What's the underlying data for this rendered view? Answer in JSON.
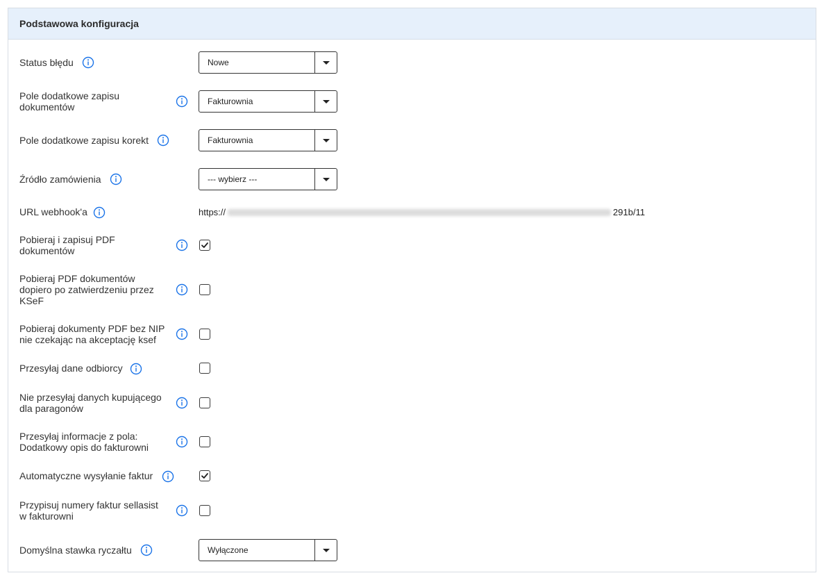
{
  "panel": {
    "title": "Podstawowa konfiguracja"
  },
  "fields": {
    "status": {
      "label": "Status błędu",
      "value": "Nowe"
    },
    "doc_field": {
      "label_line1": "Pole dodatkowe zapisu",
      "label_line2": "dokumentów",
      "value": "Fakturownia"
    },
    "correction_field": {
      "label": "Pole dodatkowe zapisu korekt",
      "value": "Fakturownia"
    },
    "order_source": {
      "label": "Źródło zamówienia",
      "value": "--- wybierz ---"
    },
    "webhook": {
      "label": "URL webhook'a",
      "prefix": "https://",
      "suffix": "291b/11"
    },
    "pdf_save": {
      "label_line1": "Pobieraj i zapisuj PDF",
      "label_line2": "dokumentów",
      "checked": true
    },
    "pdf_after_ksef": {
      "label_line1": "Pobieraj PDF dokumentów",
      "label_line2": "dopiero po zatwierdzeniu przez",
      "label_line3": "KSeF",
      "checked": false
    },
    "pdf_no_nip": {
      "label_line1": "Pobieraj dokumenty PDF bez NIP",
      "label_line2": "nie czekając na akceptację ksef",
      "checked": false
    },
    "send_recipient": {
      "label": "Przesyłaj dane odbiorcy",
      "checked": false
    },
    "no_buyer_receipts": {
      "label_line1": "Nie przesyłaj danych kupującego",
      "label_line2": "dla paragonów",
      "checked": false
    },
    "extra_description": {
      "label_line1": "Przesyłaj informacje z pola:",
      "label_line2": "Dodatkowy opis do fakturowni",
      "checked": false
    },
    "auto_send": {
      "label": "Automatyczne wysyłanie faktur",
      "checked": true
    },
    "assign_numbers": {
      "label_line1": "Przypisuj numery faktur sellasist",
      "label_line2": "w fakturowni",
      "checked": false
    },
    "lump_rate": {
      "label": "Domyślna stawka ryczałtu",
      "value": "Wyłączone"
    }
  },
  "colors": {
    "accent": "#1a73e8",
    "header_bg": "#e6f0fb",
    "border": "#333333"
  }
}
